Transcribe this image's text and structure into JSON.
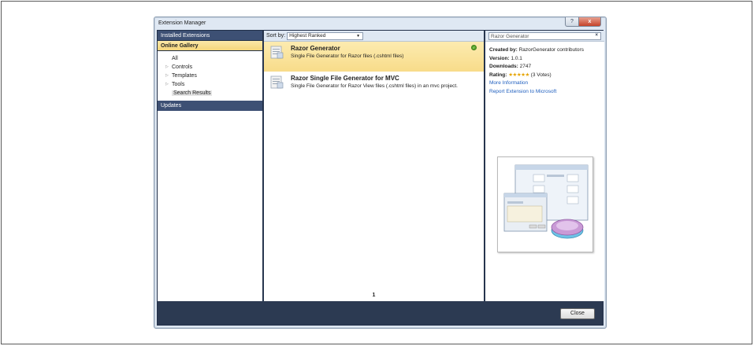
{
  "window": {
    "title": "Extension Manager",
    "help_glyph": "?",
    "close_glyph": "x"
  },
  "sidebar": {
    "installed_label": "Installed Extensions",
    "online_label": "Online Gallery",
    "tree": [
      {
        "label": "All",
        "arrow": ""
      },
      {
        "label": "Controls",
        "arrow": "▷"
      },
      {
        "label": "Templates",
        "arrow": "▷"
      },
      {
        "label": "Tools",
        "arrow": "▷"
      },
      {
        "label": "Search Results",
        "arrow": ""
      }
    ],
    "updates_label": "Updates"
  },
  "list": {
    "sort_label": "Sort by:",
    "sort_value": "Highest Ranked",
    "items": [
      {
        "name": "Razor Generator",
        "description": "Single File Generator for Razor files (.cshtml files)",
        "installed": true
      },
      {
        "name": "Razor Single File Generator for MVC",
        "description": "Single File Generator for Razor View files (.cshtml files) in an mvc project.",
        "installed": false
      }
    ],
    "page_number": "1"
  },
  "details": {
    "search_value": "Razor Generator",
    "search_clear_glyph": "×",
    "created_by_label": "Created by:",
    "created_by_value": "RazorGenerator contributors",
    "version_label": "Version:",
    "version_value": "1.0.1",
    "downloads_label": "Downloads:",
    "downloads_value": "2747",
    "rating_label": "Rating:",
    "rating_stars": "★★★★★",
    "rating_votes": "(3 Votes)",
    "more_info_link": "More Information",
    "report_link": "Report Extension to Microsoft"
  },
  "footer": {
    "close_label": "Close"
  },
  "colors": {
    "header_dark": "#2c3a52",
    "category_header": "#3d5074",
    "selection_gold": "#f8dc8a",
    "link_blue": "#1f5fbf",
    "star_gold": "#e6a400"
  }
}
